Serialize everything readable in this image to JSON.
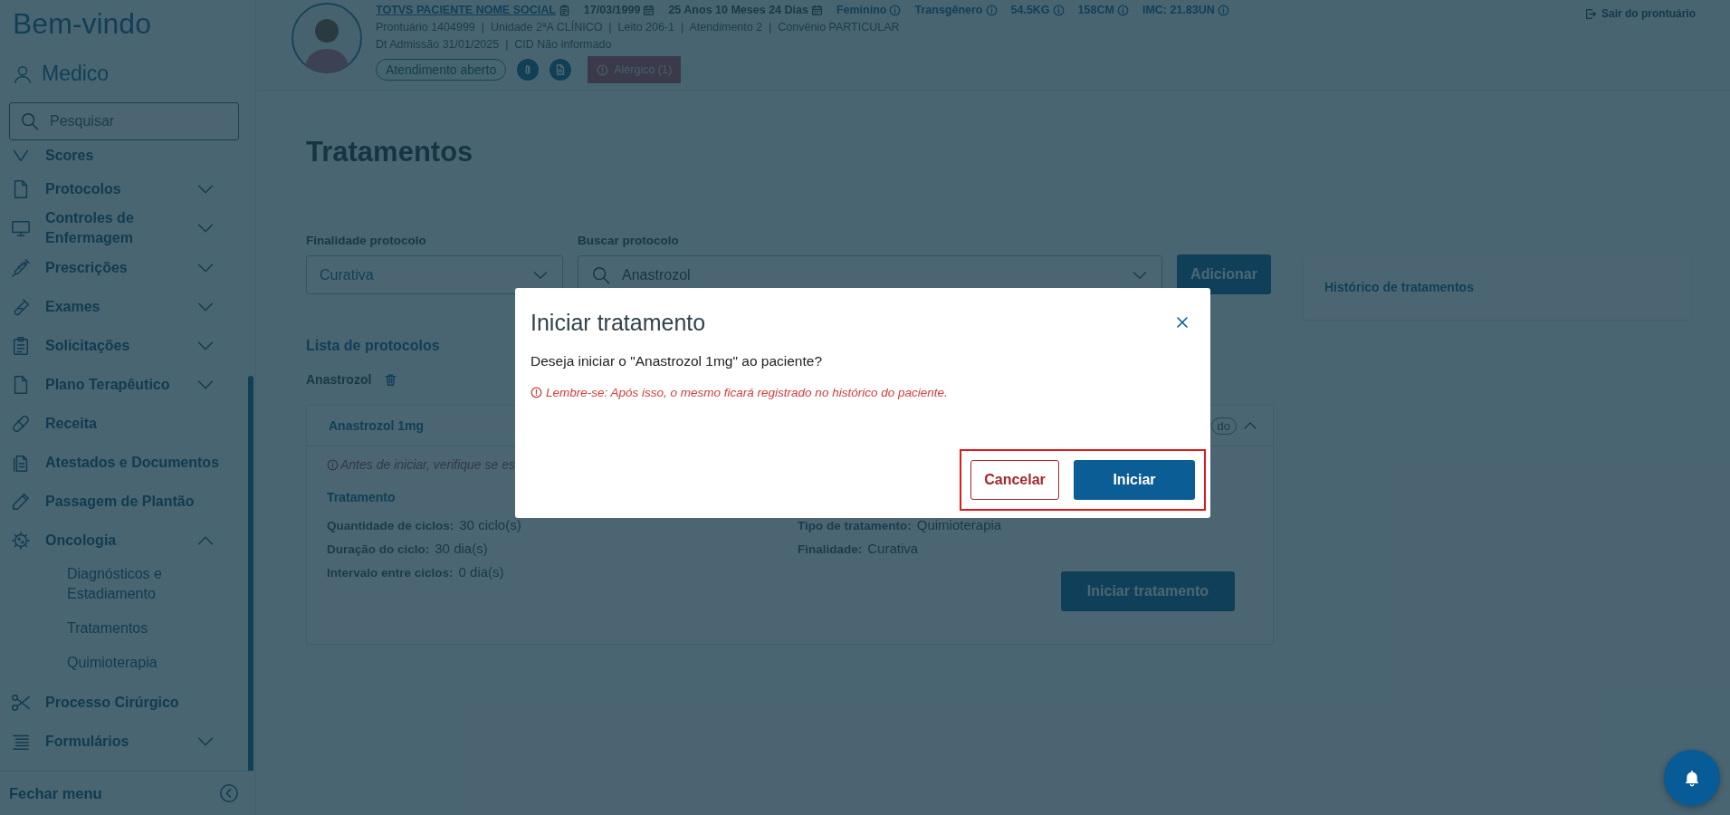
{
  "sidebar": {
    "welcome": "Bem-vindo",
    "user": "Medico",
    "search": {
      "placeholder": "Pesquisar"
    },
    "items": [
      {
        "label": "Scores"
      },
      {
        "label": "Protocolos",
        "expanded": false
      },
      {
        "label": "Controles de Enfermagem",
        "expanded": false
      },
      {
        "label": "Prescrições",
        "expanded": false
      },
      {
        "label": "Exames",
        "expanded": false
      },
      {
        "label": "Solicitações",
        "expanded": false
      },
      {
        "label": "Plano Terapêutico",
        "expanded": false
      },
      {
        "label": "Receita"
      },
      {
        "label": "Atestados e Documentos"
      },
      {
        "label": "Passagem de Plantão"
      },
      {
        "label": "Oncologia",
        "expanded": true,
        "children": [
          {
            "label": "Diagnósticos e Estadiamento"
          },
          {
            "label": "Tratamentos"
          },
          {
            "label": "Quimioterapia"
          }
        ]
      },
      {
        "label": "Processo Cirúrgico"
      },
      {
        "label": "Formulários",
        "expanded": false
      }
    ],
    "close_menu": "Fechar menu"
  },
  "patient": {
    "facts": [
      {
        "text": "TOTVS PACIENTE NOME SOCIAL",
        "kind": "name"
      },
      {
        "text": "17/03/1999",
        "kind": "date"
      },
      {
        "text": "25 Anos 10 Meses 24 Dias",
        "kind": "date"
      },
      {
        "text": "Feminino",
        "kind": "info"
      },
      {
        "text": "Transgênero",
        "kind": "info"
      },
      {
        "text": "54.5KG",
        "kind": "info"
      },
      {
        "text": "158CM",
        "kind": "info"
      },
      {
        "text": "IMC: 21.83UN",
        "kind": "info"
      }
    ],
    "lines": [
      "Prontuário 1404999  |  Unidade 2ªA CLÍNICO  |  Leito 206-1  |  Atendimento 2  |  Convênio PARTICULAR",
      "Dt Admissão 31/01/2025  |  CID Não informado"
    ],
    "status": "Atendimento aberto",
    "allergy": "Alérgico (1)",
    "exit": "Sair do prontuário"
  },
  "page": {
    "title": "Tratamentos",
    "purpose": {
      "label": "Finalidade protocolo",
      "value": "Curativa"
    },
    "protocol_search": {
      "label": "Buscar protocolo",
      "value": "Anastrozol"
    },
    "add_button": "Adicionar",
    "history": "Histórico de tratamentos",
    "list_title": "Lista de protocolos",
    "group": "Anastrozol",
    "protocol": {
      "name": "Anastrozol 1mg",
      "badge": "do",
      "expanded": true,
      "warning": "Antes de iniciar, verifique se es",
      "section": "Tratamento",
      "left": [
        {
          "label": "Quantidade de ciclos:",
          "value": "30 ciclo(s)"
        },
        {
          "label": "Duração do ciclo:",
          "value": "30 dia(s)"
        },
        {
          "label": "Intervalo entre ciclos:",
          "value": "0 dia(s)"
        }
      ],
      "right": [
        {
          "label": "Tipo de tratamento:",
          "value": "Quimioterapia"
        },
        {
          "label": "Finalidade:",
          "value": "Curativa"
        }
      ],
      "start_button": "Iniciar tratamento"
    }
  },
  "modal": {
    "title": "Iniciar tratamento",
    "question": "Deseja iniciar o \"Anastrozol 1mg\" ao paciente?",
    "warning": "Lembre-se: Após isso, o mesmo ficará registrado no histórico do paciente.",
    "buttons_highlighted": true,
    "buttons": [
      {
        "label": "Cancelar",
        "kind": "secondary"
      },
      {
        "label": "Iniciar",
        "kind": "primary"
      }
    ]
  }
}
